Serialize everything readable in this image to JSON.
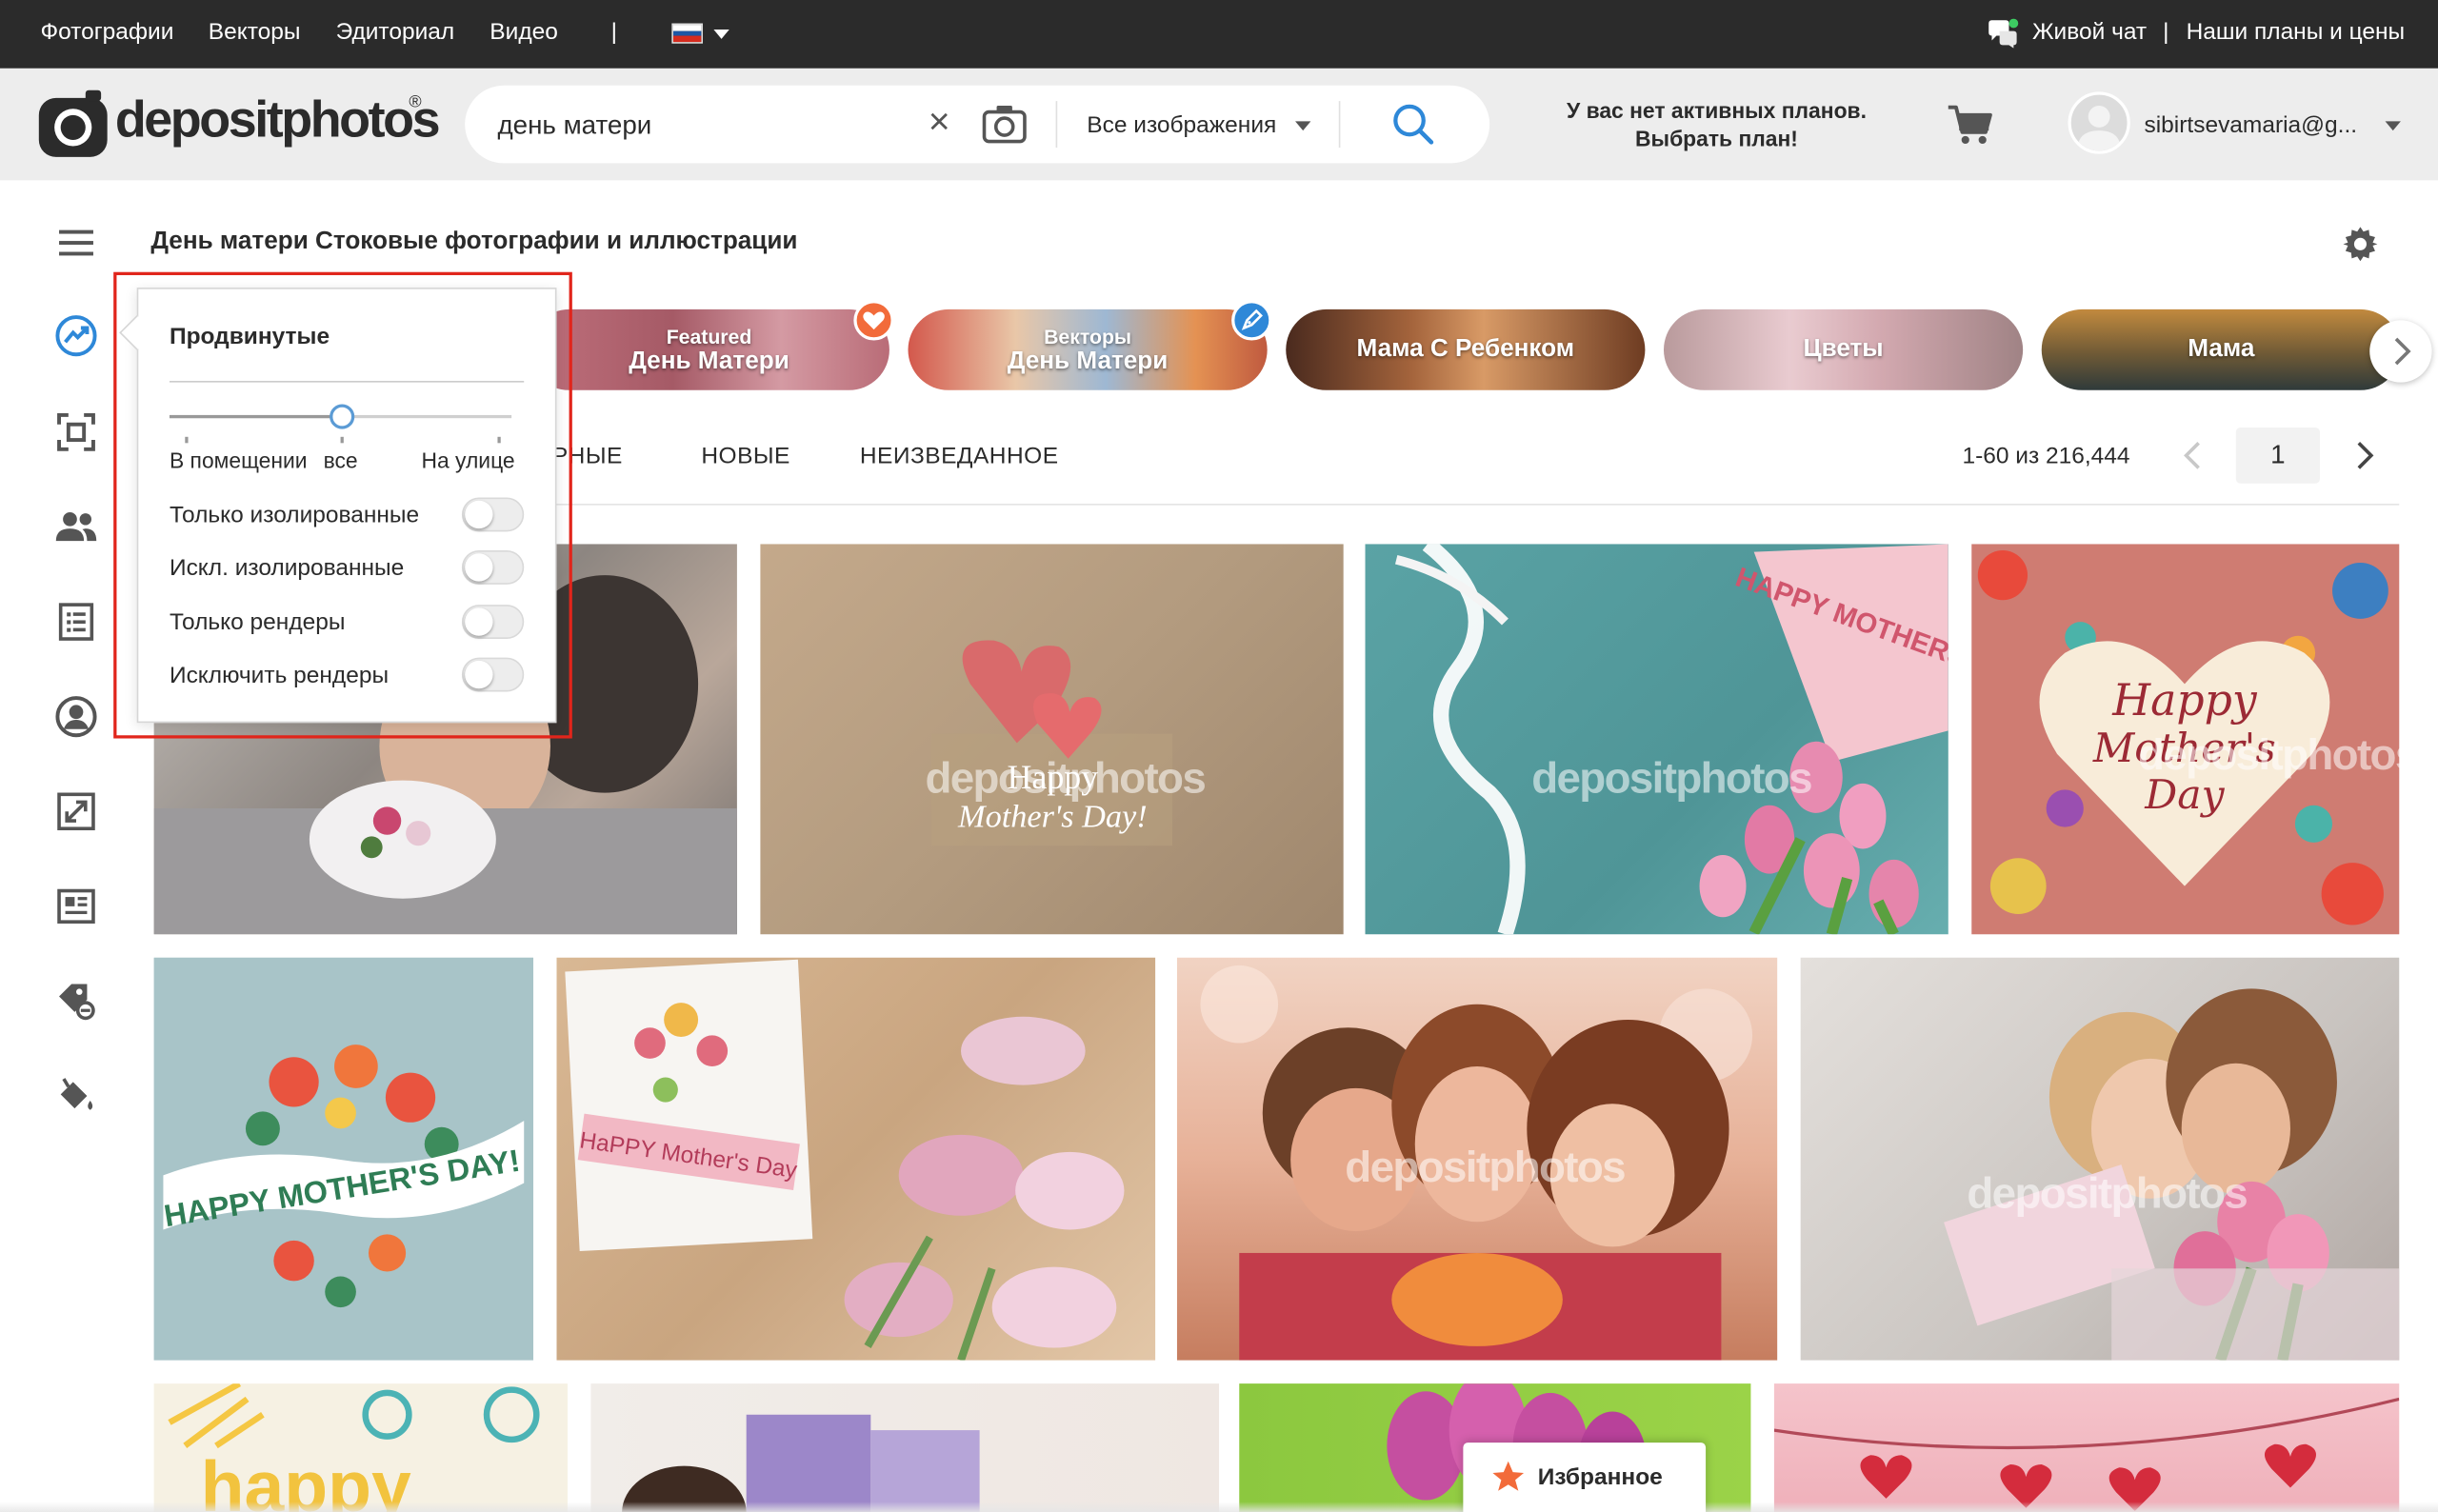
{
  "topnav": {
    "links": [
      "Фотографии",
      "Векторы",
      "Эдиториал",
      "Видео"
    ],
    "divider": "|",
    "language_flag": "russian-flag",
    "live_chat": "Живой чат",
    "separator": "|",
    "plans": "Наши планы и цены"
  },
  "header": {
    "logo_text": "depositphotos",
    "logo_reg": "®",
    "search": {
      "value": "день матери",
      "clear_glyph": "×",
      "filter_label": "Все изображения"
    },
    "plan_line1": "У вас нет активных планов.",
    "plan_line2": "Выбрать план!",
    "user_name": "sibirtsevamaria@g..."
  },
  "page_title": "День матери Стоковые фотографии и иллюстрации",
  "chips": [
    {
      "line1": "Featured",
      "line2": "День Матери",
      "badge": "heart-icon",
      "badge_color": "#f26b3a"
    },
    {
      "line1": "Векторы",
      "line2": "День Матери",
      "badge": "pen-icon",
      "badge_color": "#2e88d8"
    },
    {
      "label": "Мама С Ребенком"
    },
    {
      "label": "Цветы"
    },
    {
      "label": "Мама"
    }
  ],
  "tabs": [
    "ПОПУЛЯРНЫЕ",
    "НОВЫЕ",
    "НЕИЗВЕДАННОЕ"
  ],
  "tab_visible": {
    "first_fragment": "ЯРНЫЕ"
  },
  "pagination": {
    "count": "1-60 из 216,444",
    "page": "1"
  },
  "advanced_filters": {
    "title": "Продвинутые",
    "slider": {
      "labels": [
        "В помещении",
        "все",
        "На улице"
      ],
      "selected": "все",
      "position_fraction": 0.5
    },
    "options": [
      {
        "label": "Только изолированные",
        "on": false
      },
      {
        "label": "Искл. изолированные",
        "on": false
      },
      {
        "label": "Только рендеры",
        "on": false
      },
      {
        "label": "Исключить рендеры",
        "on": false
      }
    ]
  },
  "images": {
    "watermark": "depositphotos",
    "card2_text1": "Happy",
    "card2_text2": "Mother's Day!",
    "card4_line1": "Happy",
    "card4_line2": "Mother's",
    "card4_line3": "Day",
    "card5_text": "HAPPY MOTHER'S DAY!",
    "card6_text": "HaPPY Mother's Day",
    "card8_text": "HAPPY MOTHERS DAY",
    "card9_text": "happy"
  },
  "favorites": {
    "label": "Избранное"
  },
  "colors": {
    "topbar": "#2b2b2b",
    "header": "#ededed",
    "accent_blue": "#2e88d8",
    "highlight_red": "#e1251b",
    "favorites_star": "#f26b3a"
  }
}
